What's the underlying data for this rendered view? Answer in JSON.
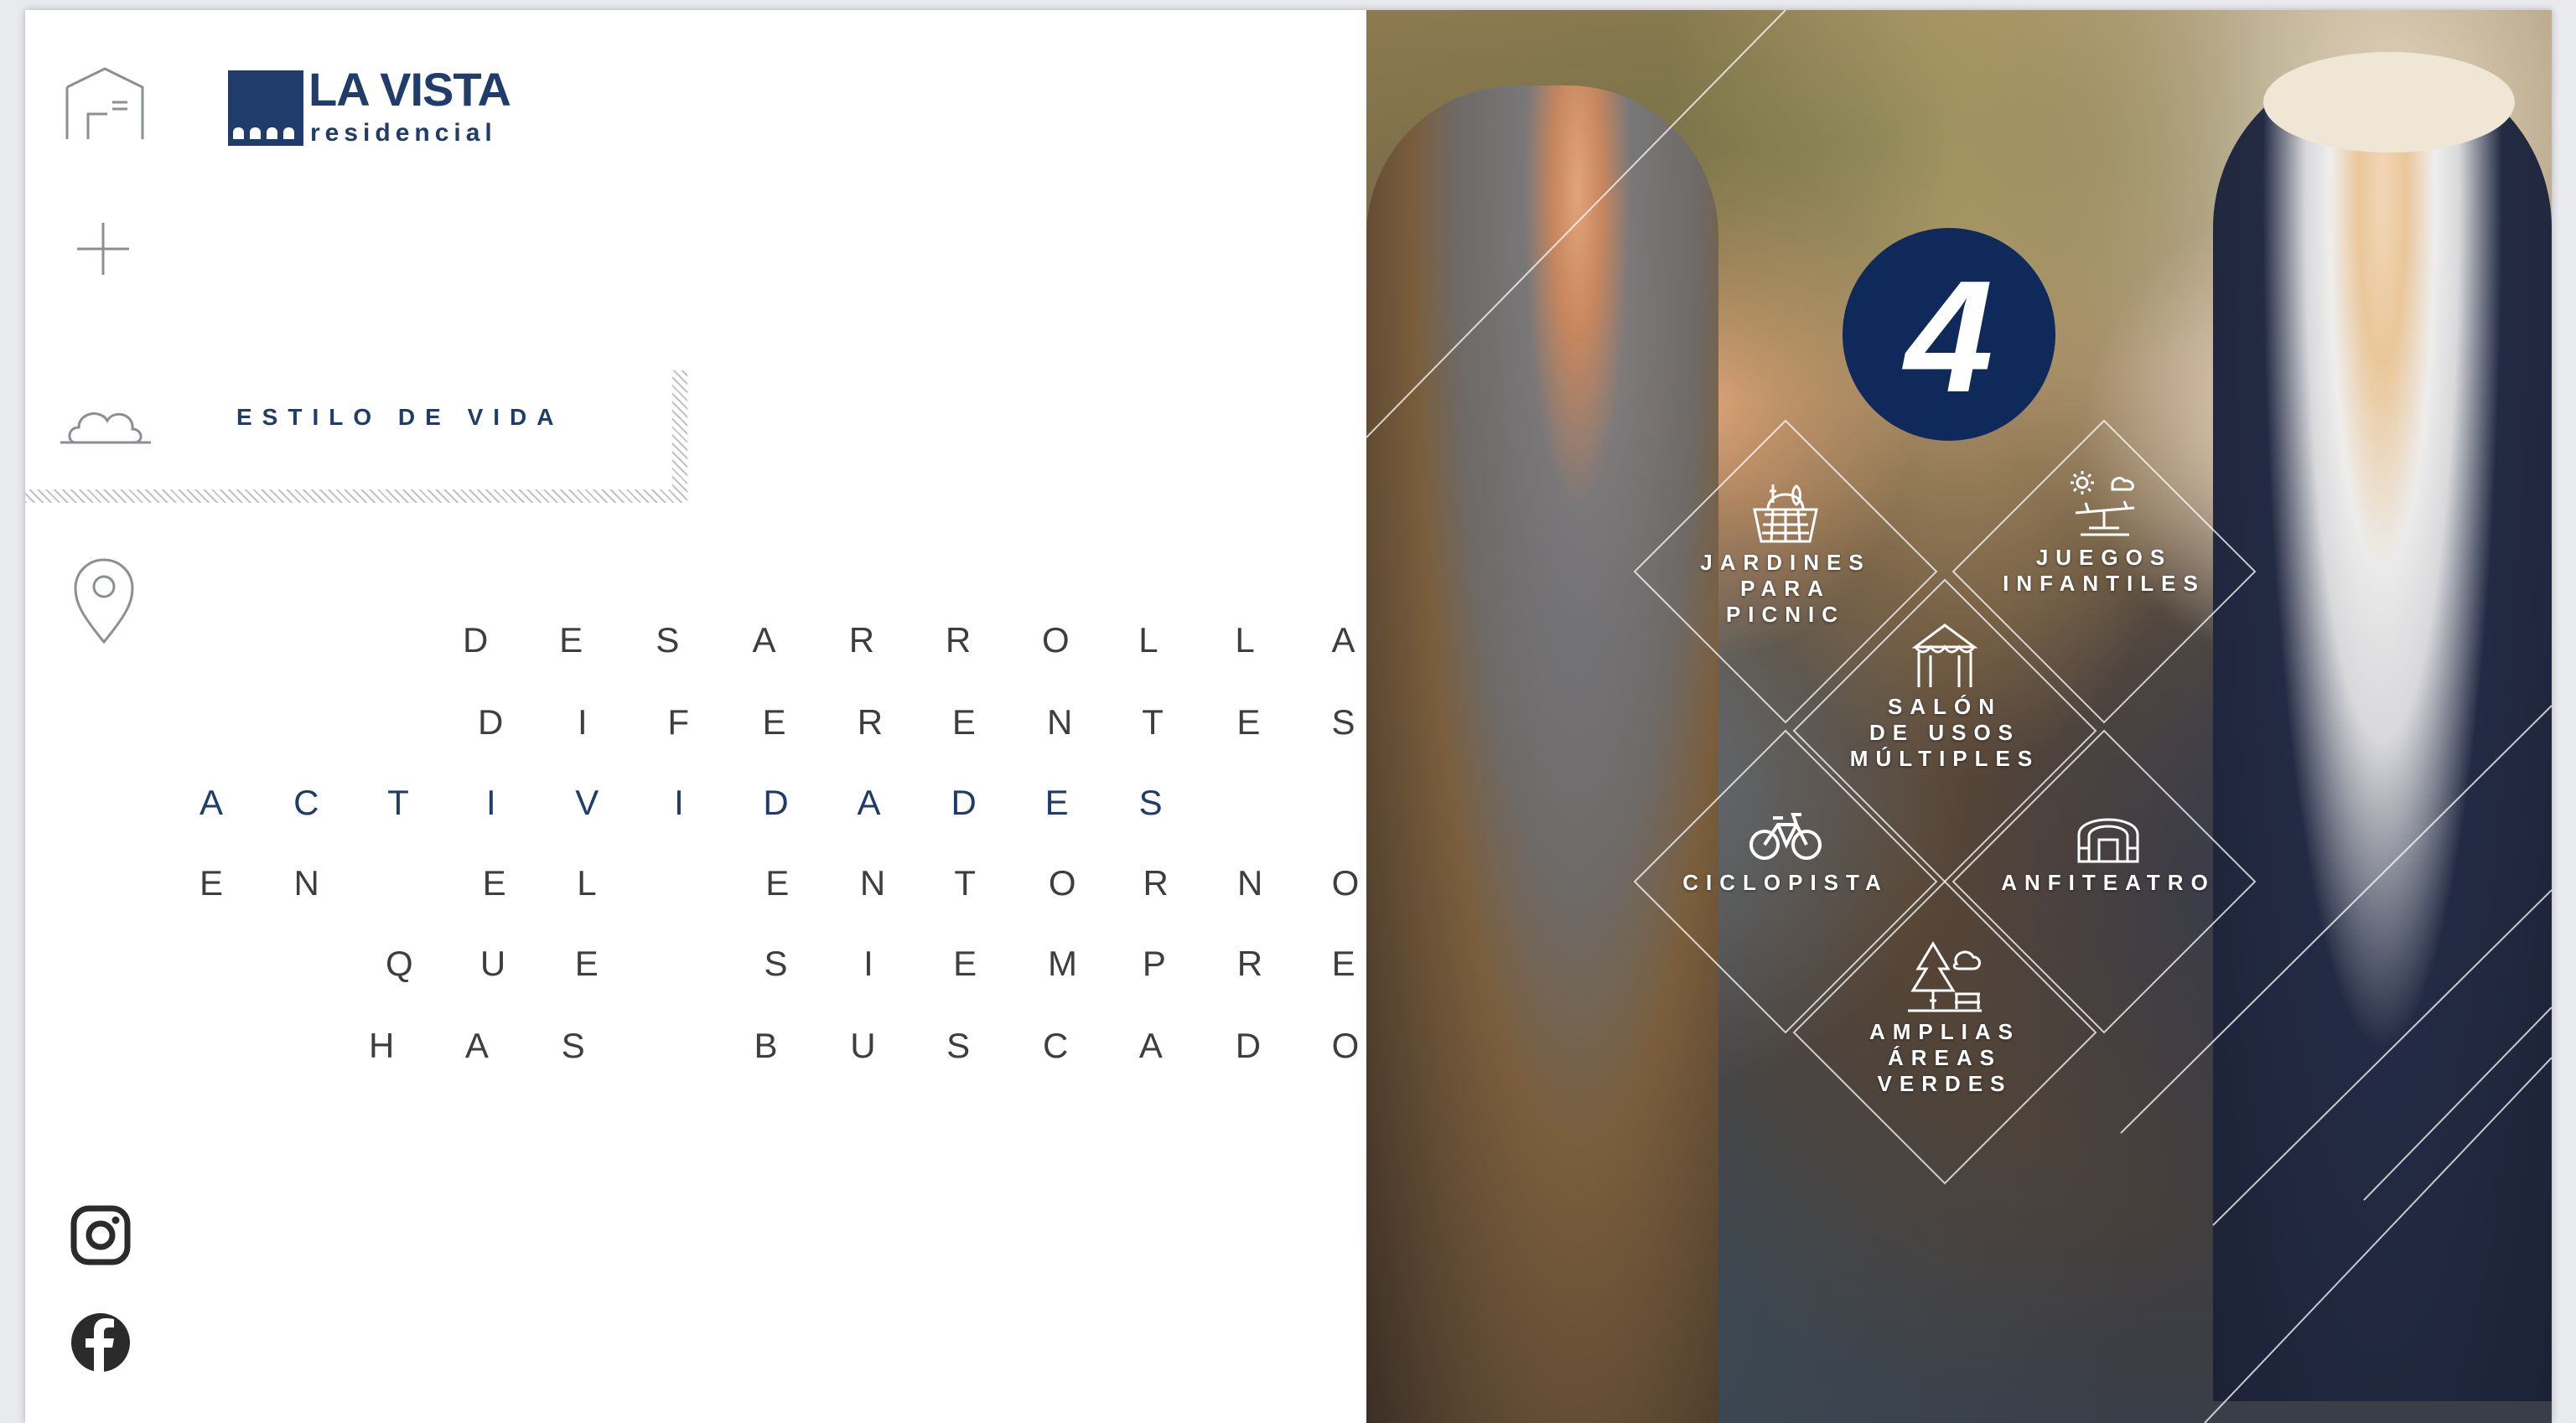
{
  "brand": {
    "name_top": "LA VISTA",
    "name_bottom": "residencial",
    "color": "#1f3c6b"
  },
  "nav": {
    "active_label": "ESTILO DE VIDA",
    "icons": [
      "home-icon",
      "plus-icon",
      "cloud-icon",
      "location-pin-icon"
    ]
  },
  "headline": {
    "lines": [
      "DESARROLLA",
      "DIFERENTES",
      "ACTIVIDADES",
      "EN EL ENTORNO",
      "QUE SIEMPRE",
      "HAS BUSCADO"
    ]
  },
  "social": [
    "instagram-icon",
    "facebook-icon"
  ],
  "badge": {
    "number": "4",
    "color": "#0f2a5a"
  },
  "amenities": [
    {
      "label_lines": [
        "JARDINES",
        "PARA",
        "PICNIC"
      ],
      "icon": "picnic-basket-icon"
    },
    {
      "label_lines": [
        "JUEGOS",
        "INFANTILES"
      ],
      "icon": "playground-icon"
    },
    {
      "label_lines": [
        "SALÓN",
        "DE USOS",
        "MÚLTIPLES"
      ],
      "icon": "tent-icon"
    },
    {
      "label_lines": [
        "CICLOPISTA"
      ],
      "icon": "bicycle-icon"
    },
    {
      "label_lines": [
        "ANFITEATRO"
      ],
      "icon": "amphitheater-icon"
    },
    {
      "label_lines": [
        "AMPLIAS",
        "ÁREAS",
        "VERDES"
      ],
      "icon": "trees-icon"
    }
  ],
  "colors": {
    "accent": "#1f3c6b",
    "text": "#3e3e3e",
    "hatch": "#bfc3c9"
  }
}
